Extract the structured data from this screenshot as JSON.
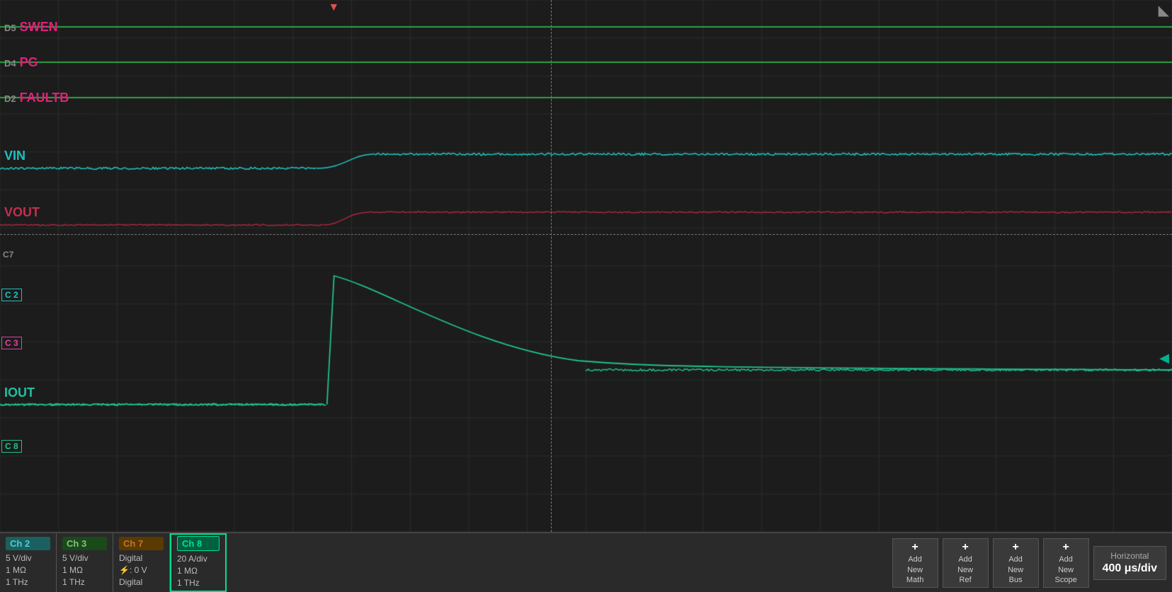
{
  "scope": {
    "background": "#1c1c1c",
    "grid_color": "#2d3a2d",
    "channels": {
      "D5": {
        "label": "D5",
        "name": "SWEN",
        "color": "#e0207a",
        "y_pct": 6
      },
      "D4": {
        "label": "D4",
        "name": "PG",
        "color": "#e0207a",
        "y_pct": 12
      },
      "D2": {
        "label": "D2",
        "name": "FAULTB",
        "color": "#e0207a",
        "y_pct": 18
      },
      "VIN": {
        "label": "VIN",
        "color": "#20c0c0",
        "y_pct": 30
      },
      "VOUT": {
        "label": "VOUT",
        "color": "#c03050",
        "y_pct": 40
      },
      "C7": {
        "label": "C7",
        "color": "#808080",
        "y_pct": 47
      },
      "C2": {
        "label": "C 2",
        "color": "#20c0c0",
        "y_pct": 53
      },
      "C3": {
        "label": "C 3",
        "color": "#e040a0",
        "y_pct": 60
      },
      "IOUT": {
        "label": "IOUT",
        "color": "#20c0a0",
        "y_pct": 73
      },
      "C8": {
        "label": "C 8",
        "color": "#20c090",
        "y_pct": 84
      }
    },
    "trigger_x_pct": 28,
    "cursor_v_pct": 47,
    "cursor_h_pct": 44
  },
  "status_bar": {
    "channels": [
      {
        "id": "ch2",
        "label": "Ch 2",
        "lines": [
          "5 V/div",
          "1 MΩ",
          "1 THz"
        ],
        "color": "#4ecfcf",
        "bg": "#1a6060"
      },
      {
        "id": "ch3",
        "label": "Ch 3",
        "lines": [
          "5 V/div",
          "1 MΩ",
          "1 THz"
        ],
        "color": "#80c080",
        "bg": "#1a4a1a"
      },
      {
        "id": "ch7",
        "label": "Ch 7",
        "lines": [
          "Digital",
          "⚡: 0 V",
          "Digital"
        ],
        "color": "#c87030",
        "bg": "#5a3a00"
      },
      {
        "id": "ch8",
        "label": "Ch 8",
        "lines": [
          "20 A/div",
          "1 MΩ",
          "1 THz"
        ],
        "color": "#00e090",
        "bg": "#006040",
        "outlined": true
      }
    ],
    "buttons": [
      {
        "id": "add-math",
        "line1": "Add",
        "line2": "New",
        "line3": "Math"
      },
      {
        "id": "add-ref",
        "line1": "Add",
        "line2": "New",
        "line3": "Ref"
      },
      {
        "id": "add-bus",
        "line1": "Add",
        "line2": "New",
        "line3": "Bus"
      },
      {
        "id": "add-scope",
        "line1": "Add",
        "line2": "New",
        "line3": "Scope"
      }
    ],
    "horizontal": {
      "title": "Horizontal",
      "value": "400 μs/div"
    }
  }
}
